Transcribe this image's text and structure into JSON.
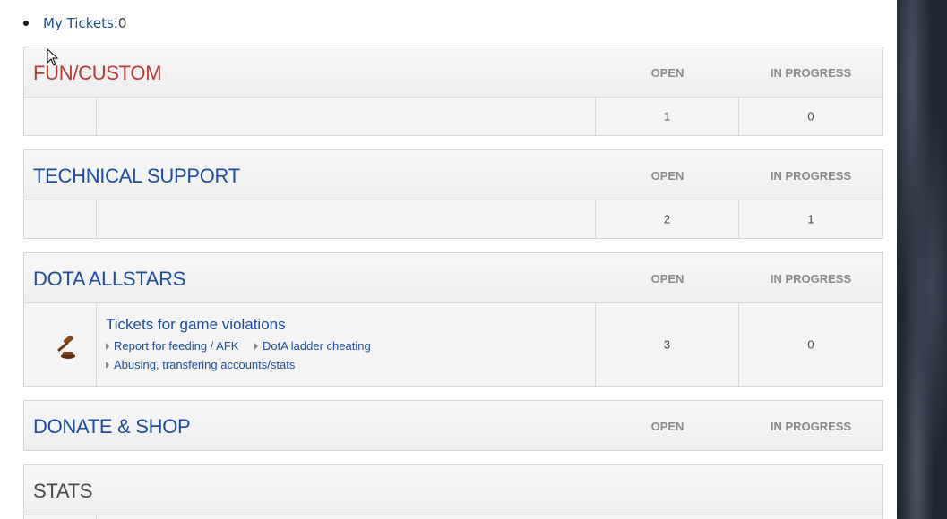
{
  "my_tickets": {
    "label": "My Tickets:",
    "count": "0"
  },
  "categories": [
    {
      "title": "FUN/CUSTOM",
      "color": "#b73a3a",
      "col_open": "OPEN",
      "col_in_progress": "IN PROGRESS",
      "row": {
        "open": "1",
        "in_progress": "0"
      }
    },
    {
      "title": "TECHNICAL SUPPORT",
      "col_open": "OPEN",
      "col_in_progress": "IN PROGRESS",
      "row": {
        "open": "2",
        "in_progress": "1"
      }
    },
    {
      "title": "DOTA ALLSTARS",
      "col_open": "OPEN",
      "col_in_progress": "IN PROGRESS",
      "row": {
        "icon": "gavel-icon",
        "forum_title": "Tickets for game violations",
        "sublinks": [
          "Report for feeding / AFK",
          "DotA ladder cheating",
          "Abusing, transfering accounts/stats"
        ],
        "open": "3",
        "in_progress": "0"
      }
    },
    {
      "title": "DONATE & SHOP",
      "col_open": "OPEN",
      "col_in_progress": "IN PROGRESS"
    },
    {
      "title": "STATS"
    }
  ],
  "colors": {
    "link": "#1e4d9b",
    "accent_red": "#b73a3a",
    "header_text": "#8a8a8a"
  }
}
